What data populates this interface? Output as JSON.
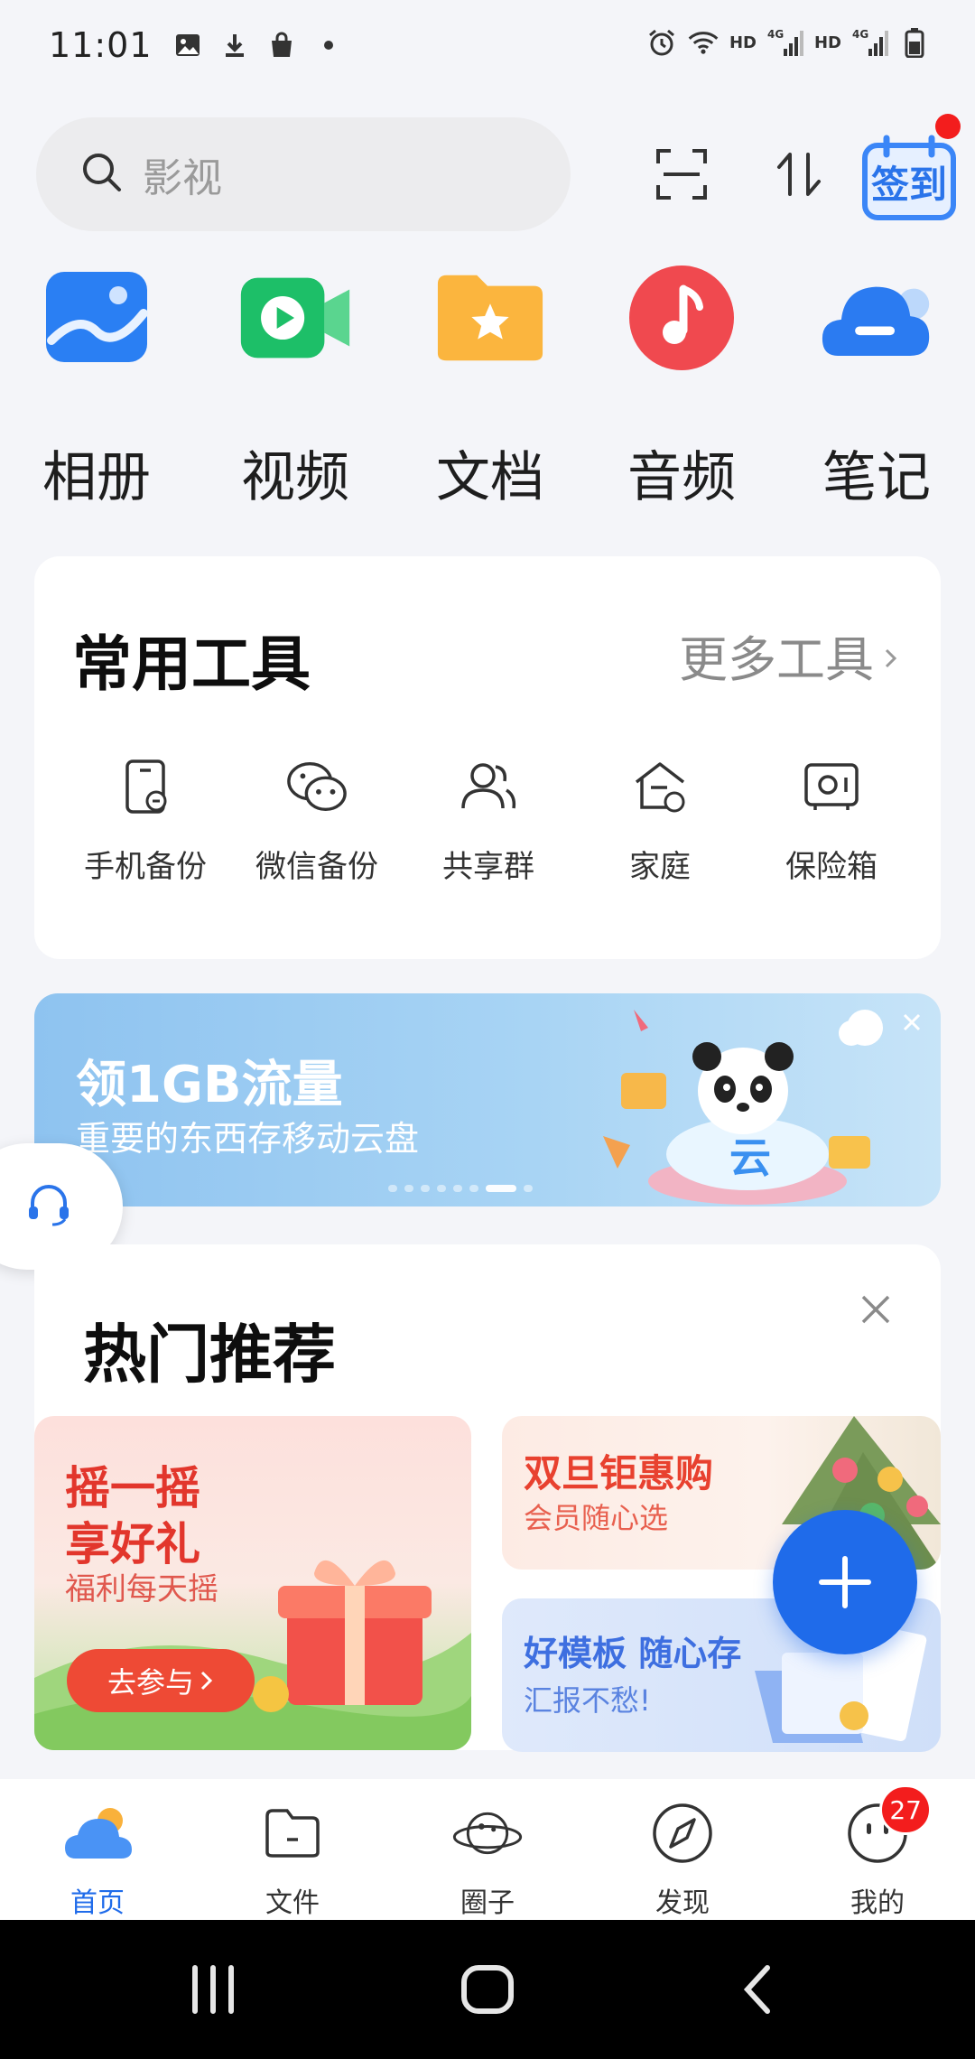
{
  "status_bar": {
    "time": "11:01",
    "left_icons": [
      "image-icon",
      "download-icon",
      "shopping-bag-icon",
      "dot-icon"
    ],
    "right_icons": [
      "alarm-icon",
      "wifi-icon",
      "signal-icon",
      "signal-icon",
      "battery-icon"
    ],
    "hd1": "HD",
    "hd2": "HD",
    "net1": "4G",
    "net2": "4G"
  },
  "search": {
    "placeholder": "影视"
  },
  "top_actions": {
    "scan_icon": "scan-icon",
    "sort_icon": "sort-icon",
    "sign_in_label": "签到"
  },
  "apps": [
    {
      "label": "相册",
      "icon": "photo-album-icon",
      "color": "#2a7ff3"
    },
    {
      "label": "视频",
      "icon": "video-icon",
      "color": "#1dbf68"
    },
    {
      "label": "文档",
      "icon": "document-folder-icon",
      "color": "#fbb53e"
    },
    {
      "label": "音频",
      "icon": "music-icon",
      "color": "#f0494f"
    },
    {
      "label": "笔记",
      "icon": "note-cloud-icon",
      "color": "#2b7bf1"
    }
  ],
  "tools": {
    "title": "常用工具",
    "more": "更多工具",
    "items": [
      {
        "label": "手机备份",
        "icon": "phone-backup-icon"
      },
      {
        "label": "微信备份",
        "icon": "wechat-backup-icon"
      },
      {
        "label": "共享群",
        "icon": "share-group-icon"
      },
      {
        "label": "家庭",
        "icon": "family-icon"
      },
      {
        "label": "保险箱",
        "icon": "safe-icon"
      }
    ]
  },
  "banner": {
    "title": "领1GB流量",
    "subtitle": "重要的东西存移动云盘",
    "cloud_text": "云",
    "slide_count": 8,
    "active_slide": 6
  },
  "hot": {
    "title": "热门推荐",
    "shake": {
      "line1": "摇一摇",
      "line2": "享好礼",
      "line3": "福利每天摇",
      "button": "去参与"
    },
    "deal": {
      "title": "双旦钜惠购",
      "subtitle": "会员随心选"
    },
    "template": {
      "title": "好模板 随心存",
      "subtitle": "汇报不愁!"
    }
  },
  "bottom_nav": [
    {
      "label": "首页",
      "icon": "home-weather-icon",
      "active": true
    },
    {
      "label": "文件",
      "icon": "file-folder-icon",
      "active": false
    },
    {
      "label": "圈子",
      "icon": "planet-icon",
      "active": false
    },
    {
      "label": "发现",
      "icon": "compass-icon",
      "active": false
    },
    {
      "label": "我的",
      "icon": "profile-face-icon",
      "active": false,
      "badge": "27"
    }
  ],
  "colors": {
    "accent": "#1f6bea",
    "badge": "#f31d1d",
    "background": "#f4f5f9"
  }
}
